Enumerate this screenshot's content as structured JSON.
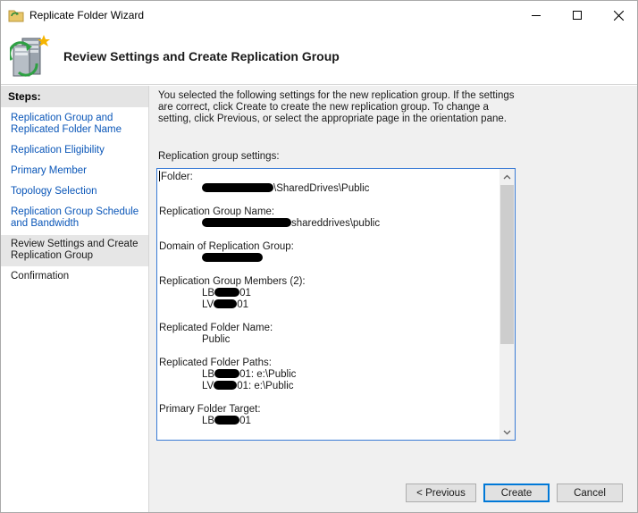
{
  "window": {
    "title": "Replicate Folder Wizard"
  },
  "header": {
    "title": "Review Settings and Create Replication Group"
  },
  "steps": {
    "heading": "Steps:",
    "items": [
      {
        "label": "Replication Group and Replicated Folder Name"
      },
      {
        "label": "Replication Eligibility"
      },
      {
        "label": "Primary Member"
      },
      {
        "label": "Topology Selection"
      },
      {
        "label": "Replication Group Schedule and Bandwidth"
      },
      {
        "label": "Review Settings and Create Replication Group"
      },
      {
        "label": "Confirmation"
      }
    ]
  },
  "main": {
    "intro": "You selected the following settings for the new replication group. If the settings are correct, click Create to create the new replication group. To change a setting, click Previous, or select the appropriate page in the orientation pane.",
    "settings_label": "Replication group settings:",
    "settings": {
      "folder_label": "Folder:",
      "folder_value_suffix": "\\SharedDrives\\Public",
      "rg_name_label": "Replication Group Name:",
      "rg_name_suffix": "shareddrives\\public",
      "domain_label": "Domain of Replication Group:",
      "members_label": "Replication Group Members (2):",
      "member1_prefix": "LB",
      "member1_suffix": "01",
      "member2_prefix": "LV",
      "member2_suffix": "01",
      "rf_name_label": "Replicated Folder Name:",
      "rf_name_value": "Public",
      "rf_paths_label": "Replicated Folder Paths:",
      "path1_prefix": "LB",
      "path1_suffix": "01: e:\\Public",
      "path2_prefix": "LV",
      "path2_suffix": "01: e:\\Public",
      "primary_label": "Primary Folder Target:",
      "primary_prefix": "LB",
      "primary_suffix": "01"
    }
  },
  "buttons": {
    "previous": "< Previous",
    "create": "Create",
    "cancel": "Cancel"
  }
}
